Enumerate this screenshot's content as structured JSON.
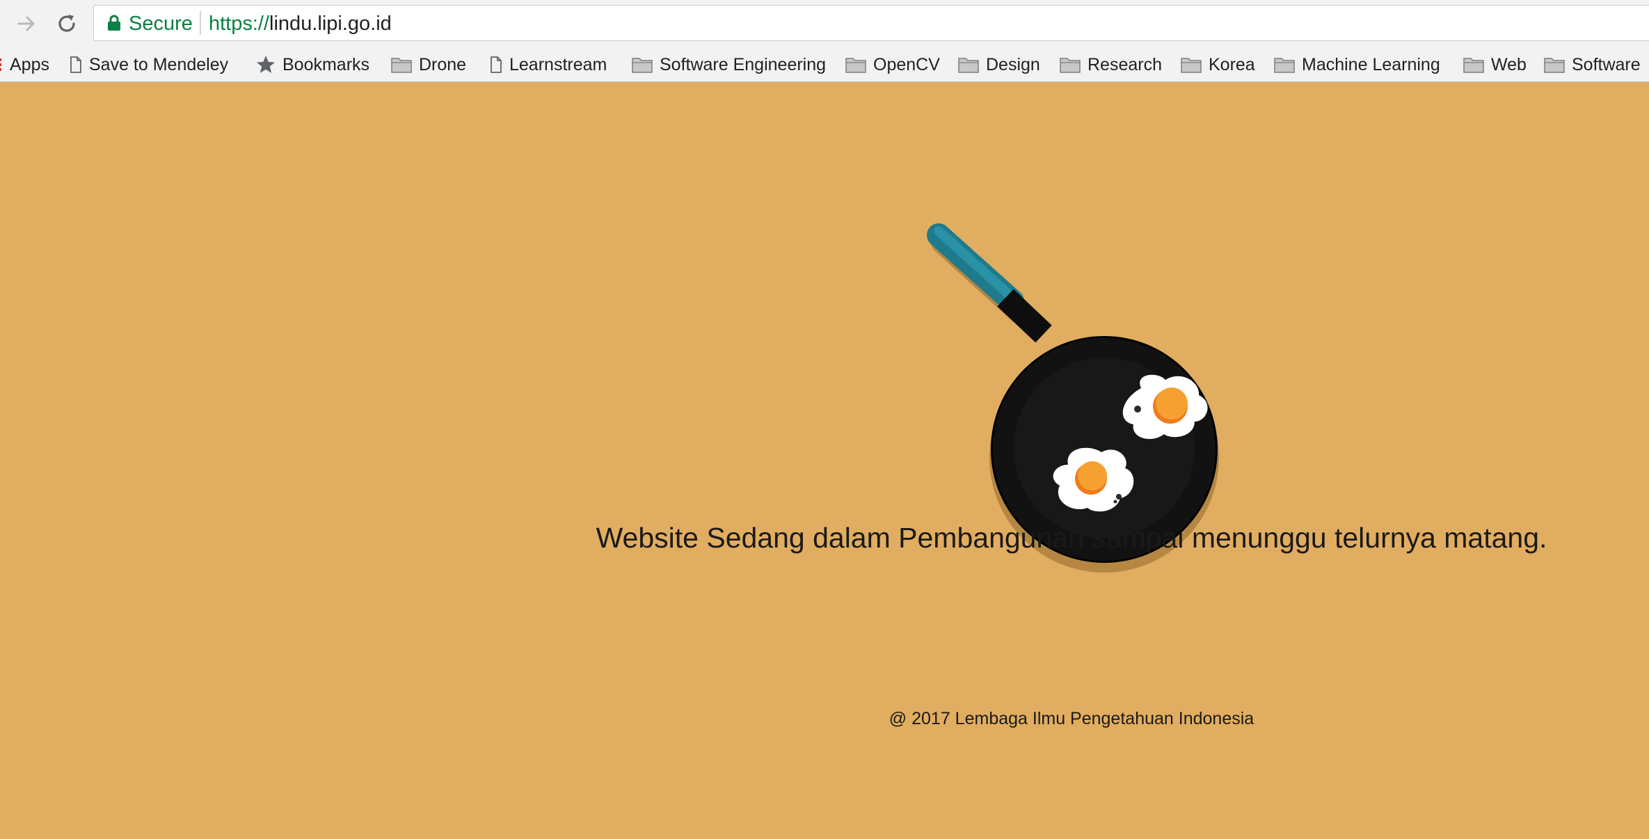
{
  "browser": {
    "security_label": "Secure",
    "url_scheme": "https://",
    "url_host": "lindu.lipi.go.id",
    "bookmarks": [
      {
        "label": "Apps",
        "icon": "apps-icon"
      },
      {
        "label": "Save to Mendeley",
        "icon": "page-icon"
      },
      {
        "label": "Bookmarks",
        "icon": "star-icon"
      },
      {
        "label": "Drone",
        "icon": "folder-icon"
      },
      {
        "label": "Learnstream",
        "icon": "page-icon"
      },
      {
        "label": "Software Engineering",
        "icon": "folder-icon"
      },
      {
        "label": "OpenCV",
        "icon": "folder-icon"
      },
      {
        "label": "Design",
        "icon": "folder-icon"
      },
      {
        "label": "Research",
        "icon": "folder-icon"
      },
      {
        "label": "Korea",
        "icon": "folder-icon"
      },
      {
        "label": "Machine Learning",
        "icon": "folder-icon"
      },
      {
        "label": "Web",
        "icon": "folder-icon"
      },
      {
        "label": "Software",
        "icon": "folder-icon"
      }
    ]
  },
  "page": {
    "background_color": "#e1ad60",
    "illustration": "frying-pan-with-eggs-icon",
    "headline": "Website Sedang dalam Pembangunan sampai menunggu telurnya matang.",
    "footer": "@ 2017 Lembaga Ilmu Pengetahuan Indonesia"
  },
  "colors": {
    "secure_green": "#0b8043",
    "pan_handle": "#1f7a8c",
    "egg_yolk": "#f5901e"
  }
}
